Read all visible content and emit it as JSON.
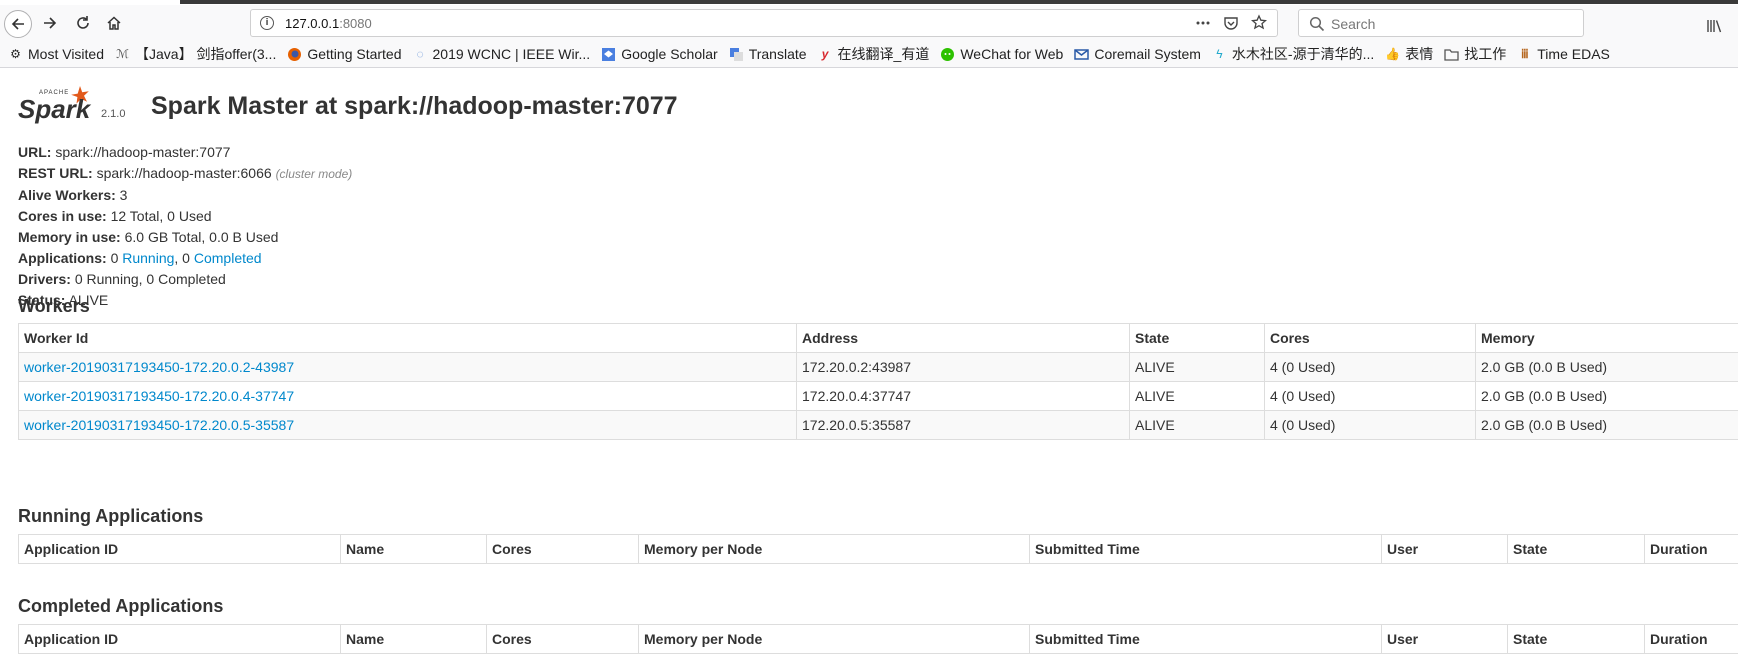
{
  "browser": {
    "url_host": "127.0.0.1",
    "url_port": ":8080",
    "search_placeholder": "Search"
  },
  "bookmarks": [
    {
      "label": "Most Visited",
      "icon": "gear-icon"
    },
    {
      "label": "【Java】 剑指offer(3...",
      "icon": "bookmark-icon"
    },
    {
      "label": "Getting Started",
      "icon": "firefox-icon"
    },
    {
      "label": "2019 WCNC | IEEE Wir...",
      "icon": "bookmark-icon"
    },
    {
      "label": "Google Scholar",
      "icon": "scholar-icon"
    },
    {
      "label": "Translate",
      "icon": "translate-icon"
    },
    {
      "label": "在线翻译_有道",
      "icon": "youdao-icon"
    },
    {
      "label": "WeChat for Web",
      "icon": "wechat-icon"
    },
    {
      "label": "Coremail System",
      "icon": "mail-icon"
    },
    {
      "label": "水木社区-源于清华的...",
      "icon": "bookmark-icon"
    },
    {
      "label": "表情",
      "icon": "thumbs-up-icon"
    },
    {
      "label": "找工作",
      "icon": "folder-icon"
    },
    {
      "label": "Time EDAS",
      "icon": "bookmark-icon"
    }
  ],
  "spark": {
    "logo_small": "APACHE",
    "logo_text": "Spark",
    "version": "2.1.0",
    "title": "Spark Master at spark://hadoop-master:7077",
    "url_label": "URL:",
    "url_value": "spark://hadoop-master:7077",
    "rest_label": "REST URL:",
    "rest_value": "spark://hadoop-master:6066",
    "rest_mode": "(cluster mode)",
    "workers_label": "Alive Workers:",
    "workers_value": "3",
    "cores_label": "Cores in use:",
    "cores_value": "12 Total, 0 Used",
    "memory_label": "Memory in use:",
    "memory_value": "6.0 GB Total, 0.0 B Used",
    "apps_label": "Applications:",
    "apps_running_count": "0",
    "apps_running_link": "Running",
    "apps_sep": ", 0",
    "apps_completed_link": "Completed",
    "drivers_label": "Drivers:",
    "drivers_value": "0 Running, 0 Completed",
    "status_label": "Status:",
    "status_value": "ALIVE"
  },
  "workers": {
    "heading": "Workers",
    "columns": [
      "Worker Id",
      "Address",
      "State",
      "Cores",
      "Memory"
    ],
    "rows": [
      [
        "worker-20190317193450-172.20.0.2-43987",
        "172.20.0.2:43987",
        "ALIVE",
        "4 (0 Used)",
        "2.0 GB (0.0 B Used)"
      ],
      [
        "worker-20190317193450-172.20.0.4-37747",
        "172.20.0.4:37747",
        "ALIVE",
        "4 (0 Used)",
        "2.0 GB (0.0 B Used)"
      ],
      [
        "worker-20190317193450-172.20.0.5-35587",
        "172.20.0.5:35587",
        "ALIVE",
        "4 (0 Used)",
        "2.0 GB (0.0 B Used)"
      ]
    ]
  },
  "running": {
    "heading": "Running Applications",
    "columns": [
      "Application ID",
      "Name",
      "Cores",
      "Memory per Node",
      "Submitted Time",
      "User",
      "State",
      "Duration"
    ]
  },
  "completed": {
    "heading": "Completed Applications",
    "columns": [
      "Application ID",
      "Name",
      "Cores",
      "Memory per Node",
      "Submitted Time",
      "User",
      "State",
      "Duration"
    ]
  }
}
